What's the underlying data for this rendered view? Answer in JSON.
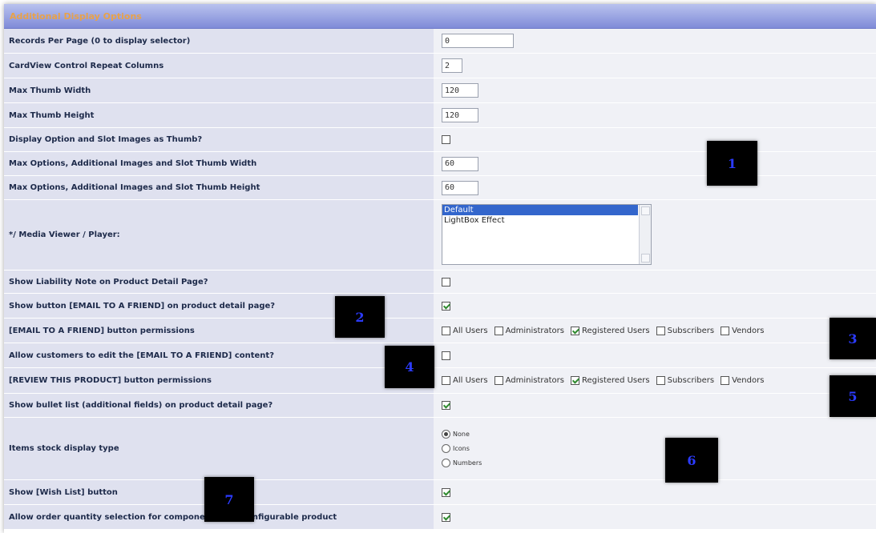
{
  "section_title": "Additional Display Options",
  "rows": [
    {
      "label": "Records Per Page (0 to display selector)",
      "value": "0"
    },
    {
      "label": "CardView Control Repeat Columns",
      "value": "2"
    },
    {
      "label": "Max Thumb Width",
      "value": "120"
    },
    {
      "label": "Max Thumb Height",
      "value": "120"
    },
    {
      "label": "Display Option and Slot Images as Thumb?"
    },
    {
      "label": "Max Options, Additional Images and Slot Thumb Width",
      "value": "60"
    },
    {
      "label": "Max Options, Additional Images and Slot Thumb Height",
      "value": "60"
    },
    {
      "label": "*/ Media Viewer / Player:",
      "options": [
        "Default",
        "LightBox Effect"
      ],
      "selected": "Default"
    },
    {
      "label": "Show Liability Note on Product Detail Page?"
    },
    {
      "label": "Show button [EMAIL TO A FRIEND] on product detail page?"
    },
    {
      "label": "[EMAIL TO A FRIEND] button permissions"
    },
    {
      "label": "Allow customers to edit the [EMAIL TO A FRIEND] content?"
    },
    {
      "label": "[REVIEW THIS PRODUCT] button permissions"
    },
    {
      "label": "Show bullet list (additional fields) on product detail page?"
    },
    {
      "label": "Items stock display type",
      "options": [
        "None",
        "Icons",
        "Numbers"
      ],
      "selected": "None"
    },
    {
      "label": "Show [Wish List] button"
    },
    {
      "label": "Allow order quantity selection for components of a configurable product"
    }
  ],
  "permissions": [
    "All Users",
    "Administrators",
    "Registered Users",
    "Subscribers",
    "Vendors"
  ],
  "checked_permission": "Registered Users",
  "callouts": [
    "1",
    "2",
    "3",
    "4",
    "5",
    "6",
    "7"
  ],
  "colors": {
    "header": "#7f8bd8",
    "header_text": "#e8a24a",
    "label_bg": "#dfe1ef",
    "value_bg": "#f0f1f6",
    "badge_text": "#2b3bff"
  }
}
